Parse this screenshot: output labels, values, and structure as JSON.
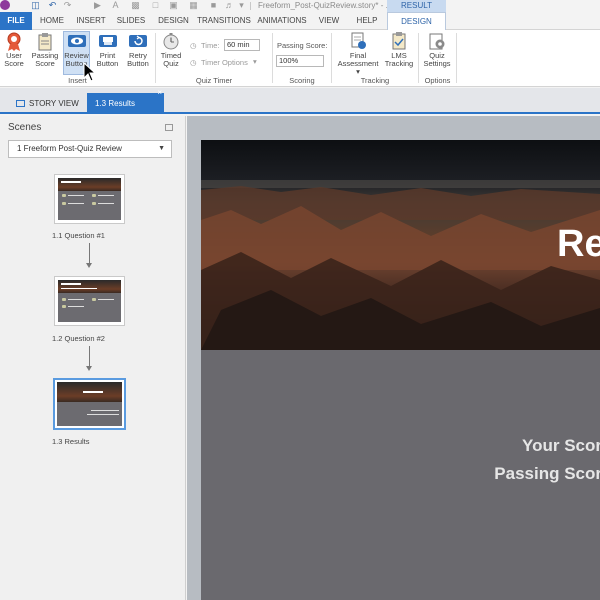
{
  "titlebar": {
    "doc_title": "Freeform_Post-QuizReview.story* - ...",
    "context_tab": "RESULT TOOLS",
    "quick_access": [
      "save-icon",
      "undo-icon",
      "redo-icon"
    ]
  },
  "ribbon_tabs": [
    {
      "label": "FILE"
    },
    {
      "label": "HOME"
    },
    {
      "label": "INSERT"
    },
    {
      "label": "SLIDES"
    },
    {
      "label": "DESIGN"
    },
    {
      "label": "TRANSITIONS"
    },
    {
      "label": "ANIMATIONS"
    },
    {
      "label": "VIEW"
    },
    {
      "label": "HELP"
    },
    {
      "label": "DESIGN",
      "active": true
    }
  ],
  "ribbon": {
    "insert_group": {
      "label": "Insert",
      "buttons": [
        {
          "line1": "User",
          "line2": "Score",
          "icon": "ribbon-badge-icon"
        },
        {
          "line1": "Passing",
          "line2": "Score",
          "icon": "clipboard-icon"
        },
        {
          "line1": "Review",
          "line2": "Button",
          "icon": "eye-icon",
          "active": true
        },
        {
          "line1": "Print",
          "line2": "Button",
          "icon": "printer-icon"
        },
        {
          "line1": "Retry",
          "line2": "Button",
          "icon": "retry-icon"
        }
      ]
    },
    "quiz_timer_group": {
      "label": "Quiz Timer",
      "timed_quiz": {
        "line1": "Timed",
        "line2": "Quiz"
      },
      "time_label": "Time:",
      "time_value": "60 min",
      "timer_options": "Timer Options"
    },
    "scoring_group": {
      "label": "Scoring",
      "passing_score_label": "Passing Score:",
      "passing_score_value": "100%"
    },
    "tracking_group": {
      "label": "Tracking",
      "final_assessment": {
        "line1": "Final",
        "line2": "Assessment"
      },
      "lms_tracking": {
        "line1": "LMS",
        "line2": "Tracking"
      }
    },
    "options_group": {
      "label": "Options",
      "quiz_settings": {
        "line1": "Quiz",
        "line2": "Settings"
      }
    }
  },
  "doc_tabs": [
    {
      "label": "STORY VIEW"
    },
    {
      "label": "1.3 Results",
      "active": true
    }
  ],
  "scenes": {
    "title": "Scenes",
    "selected_scene": "1 Freeform Post-Quiz Review",
    "slides": [
      {
        "label": "1.1 Question #1"
      },
      {
        "label": "1.2 Question #2"
      },
      {
        "label": "1.3 Results",
        "selected": true
      }
    ]
  },
  "slide": {
    "title_fragment": "Re",
    "your_score_fragment": "Your Scor",
    "passing_score_fragment": "Passing Scor"
  },
  "colors": {
    "accent": "#2b74c7",
    "slide_bg": "#6a696e",
    "canvas_bg": "#b7bcc2"
  }
}
